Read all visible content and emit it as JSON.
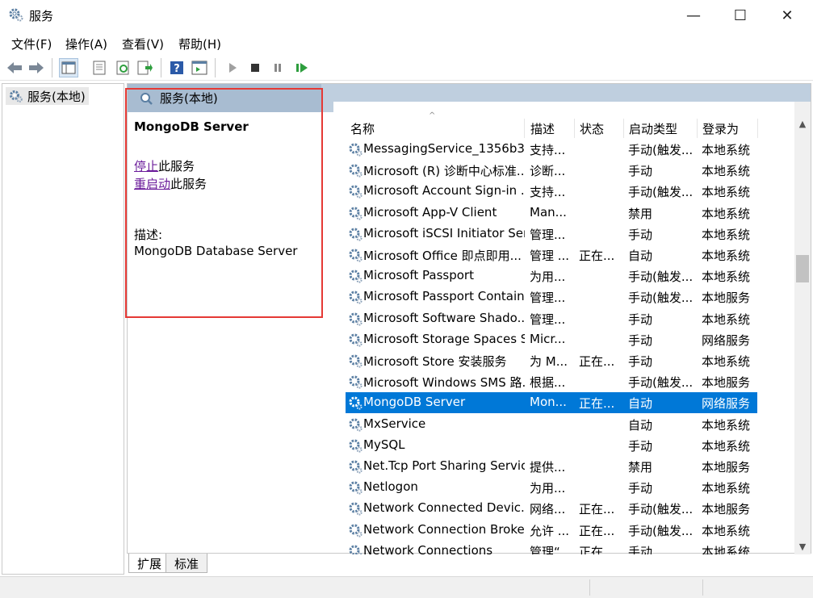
{
  "window": {
    "title": "服务",
    "app_icon": "gears-icon",
    "controls": {
      "minimize": "—",
      "maximize": "☐",
      "close": "✕"
    }
  },
  "menu": [
    "文件(F)",
    "操作(A)",
    "查看(V)",
    "帮助(H)"
  ],
  "toolbar": {
    "icons": [
      "back-arrow-icon",
      "forward-arrow-icon",
      "show-tree-icon",
      "properties-icon",
      "refresh-icon",
      "export-list-icon",
      "help-icon",
      "console-icon",
      "start-service-icon",
      "stop-service-icon",
      "pause-service-icon",
      "resume-service-icon"
    ]
  },
  "tree": {
    "root": "服务(本地)"
  },
  "panel": {
    "header": "服务(本地)",
    "service_name": "MongoDB Server",
    "stop_link": "停止",
    "stop_suffix": "此服务",
    "restart_link": "重启动",
    "restart_suffix": "此服务",
    "desc_label": "描述:",
    "desc_text": "MongoDB Database Server"
  },
  "table": {
    "columns": [
      "名称",
      "描述",
      "状态",
      "启动类型",
      "登录为"
    ],
    "rows": [
      {
        "name": "MessagingService_1356b3...",
        "desc": "支持...",
        "state": "",
        "start": "手动(触发...",
        "logon": "本地系统"
      },
      {
        "name": "Microsoft (R) 诊断中心标准...",
        "desc": "诊断...",
        "state": "",
        "start": "手动",
        "logon": "本地系统"
      },
      {
        "name": "Microsoft Account Sign-in ...",
        "desc": "支持...",
        "state": "",
        "start": "手动(触发...",
        "logon": "本地系统"
      },
      {
        "name": "Microsoft App-V Client",
        "desc": "Man...",
        "state": "",
        "start": "禁用",
        "logon": "本地系统"
      },
      {
        "name": "Microsoft iSCSI Initiator Ser...",
        "desc": "管理...",
        "state": "",
        "start": "手动",
        "logon": "本地系统"
      },
      {
        "name": "Microsoft Office 即点即用...",
        "desc": "管理 ...",
        "state": "正在...",
        "start": "自动",
        "logon": "本地系统"
      },
      {
        "name": "Microsoft Passport",
        "desc": "为用...",
        "state": "",
        "start": "手动(触发...",
        "logon": "本地系统"
      },
      {
        "name": "Microsoft Passport Container",
        "desc": "管理...",
        "state": "",
        "start": "手动(触发...",
        "logon": "本地服务"
      },
      {
        "name": "Microsoft Software Shado...",
        "desc": "管理...",
        "state": "",
        "start": "手动",
        "logon": "本地系统"
      },
      {
        "name": "Microsoft Storage Spaces S...",
        "desc": "Micr...",
        "state": "",
        "start": "手动",
        "logon": "网络服务"
      },
      {
        "name": "Microsoft Store 安装服务",
        "desc": "为 M...",
        "state": "正在...",
        "start": "手动",
        "logon": "本地系统"
      },
      {
        "name": "Microsoft Windows SMS 路...",
        "desc": "根据...",
        "state": "",
        "start": "手动(触发...",
        "logon": "本地服务"
      },
      {
        "name": "MongoDB Server",
        "desc": "Mon...",
        "state": "正在...",
        "start": "自动",
        "logon": "网络服务",
        "selected": true
      },
      {
        "name": "MxService",
        "desc": "",
        "state": "",
        "start": "自动",
        "logon": "本地系统"
      },
      {
        "name": "MySQL",
        "desc": "",
        "state": "",
        "start": "手动",
        "logon": "本地系统"
      },
      {
        "name": "Net.Tcp Port Sharing Service",
        "desc": "提供...",
        "state": "",
        "start": "禁用",
        "logon": "本地服务"
      },
      {
        "name": "Netlogon",
        "desc": "为用...",
        "state": "",
        "start": "手动",
        "logon": "本地系统"
      },
      {
        "name": "Network Connected Devic...",
        "desc": "网络...",
        "state": "正在...",
        "start": "手动(触发...",
        "logon": "本地服务"
      },
      {
        "name": "Network Connection Broker",
        "desc": "允许 ...",
        "state": "正在...",
        "start": "手动(触发...",
        "logon": "本地系统"
      },
      {
        "name": "Network Connections",
        "desc": "管理“...",
        "state": "正在...",
        "start": "手动",
        "logon": "本地系统"
      }
    ]
  },
  "tabs": [
    "扩展",
    "标准"
  ],
  "colors": {
    "selection": "#0078d7",
    "highlight_box": "#e53935",
    "header_band": "#a8bcd1"
  }
}
